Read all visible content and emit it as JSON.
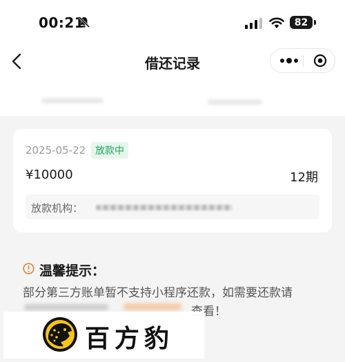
{
  "status_bar": {
    "time": "00:21",
    "battery": "82",
    "icons": [
      "bell-off-icon",
      "signal-icon",
      "wifi-icon",
      "battery-icon"
    ]
  },
  "nav": {
    "title": "借还记录",
    "back_icon": "chevron-left-icon",
    "more_icon": "more-dots-icon",
    "close_icon": "target-close-icon"
  },
  "record": {
    "date": "2025-05-22",
    "status": "放款中",
    "amount": "¥10000",
    "term": "12期",
    "institution_label": "放款机构："
  },
  "tips": {
    "title": "温馨提示：",
    "line1": "部分第三方账单暂不支持小程序还款，如需要还款请",
    "line2": "查看！"
  },
  "watermark": {
    "text": "百方豹",
    "logo": "leopard-logo"
  },
  "colors": {
    "status_green": "#1ba55a",
    "status_badge_bg": "#e6f6ec",
    "warning_orange": "#e07b2a",
    "page_bg": "#f4f4f4"
  }
}
